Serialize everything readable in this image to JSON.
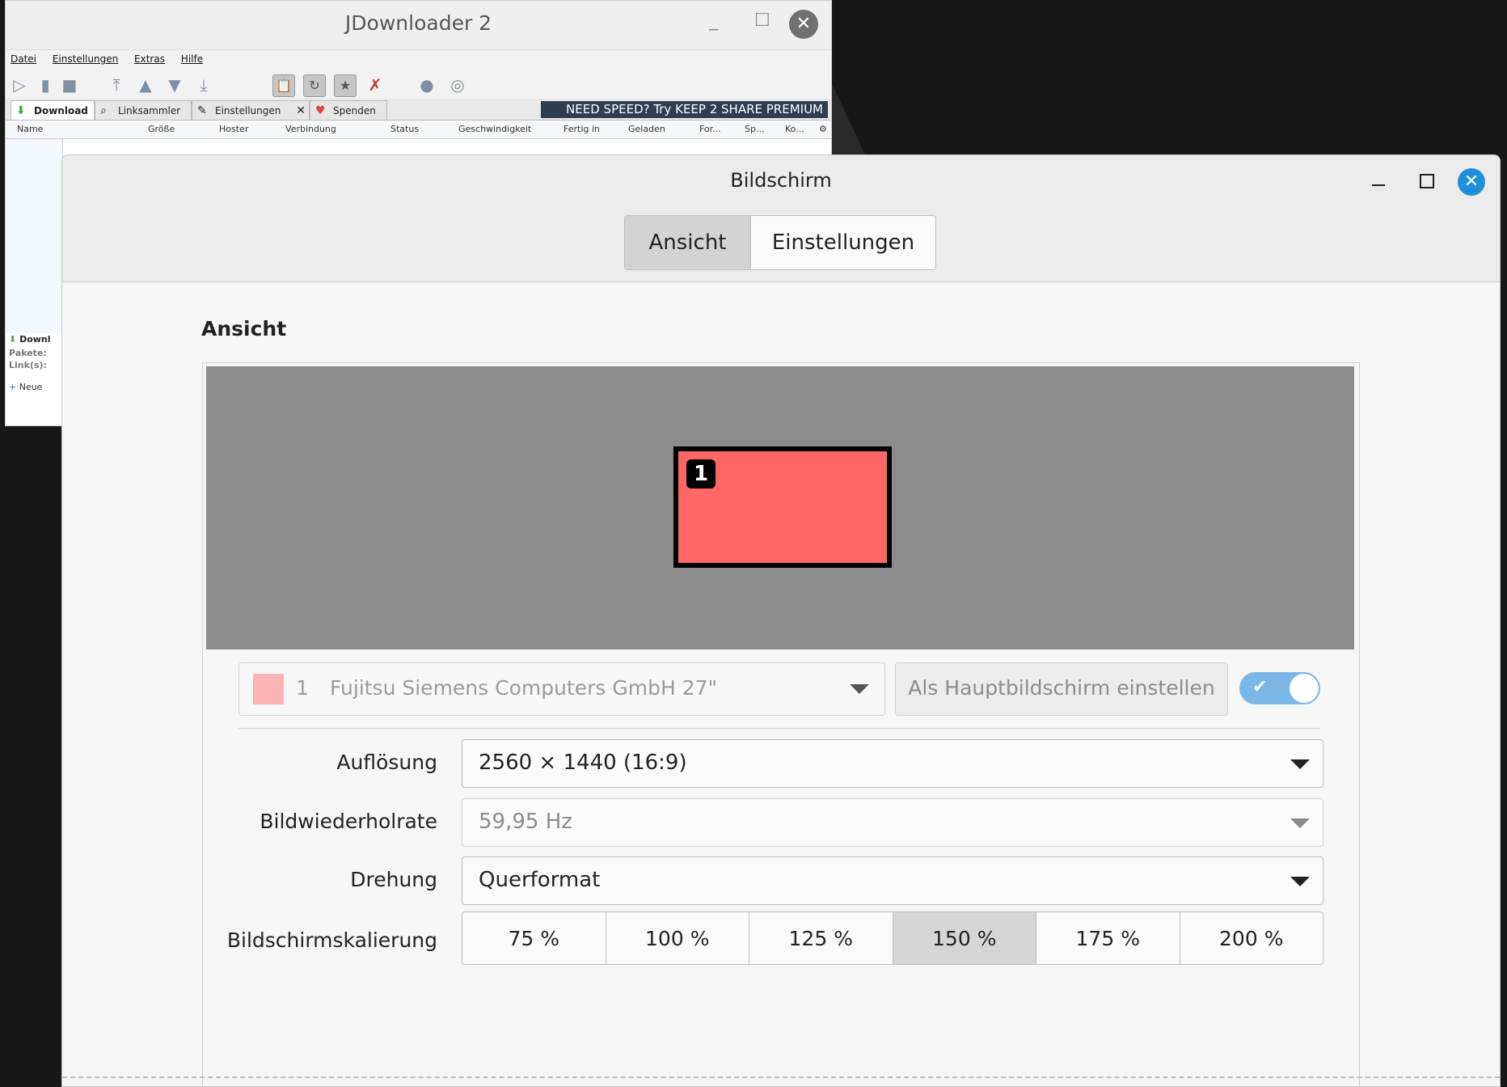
{
  "jdownloader": {
    "title": "JDownloader 2",
    "menu": [
      "Datei",
      "Einstellungen",
      "Extras",
      "Hilfe"
    ],
    "tabs": [
      "Download",
      "Linksammler",
      "Einstellungen",
      "Spenden"
    ],
    "banner": "NEED SPEED? Try KEEP 2 SHARE PREMIUM",
    "columns": [
      "Name",
      "Größe",
      "Hoster",
      "Verbindung",
      "Status",
      "Geschwindigkeit",
      "Fertig in",
      "Geladen",
      "For...",
      "Sp...",
      "Ko..."
    ],
    "bottom_panel": {
      "title": "Downl",
      "packages_label": "Pakete:",
      "links_label": "Link(s):",
      "new_button": "Neue"
    }
  },
  "display_window": {
    "title": "Bildschirm",
    "tabs": {
      "view": "Ansicht",
      "settings": "Einstellungen"
    },
    "section_title": "Ansicht",
    "monitor": {
      "number": "1",
      "name": "Fujitsu Siemens Computers GmbH 27\"",
      "color": "#fe6766",
      "swatch_color": "#fbb3b3"
    },
    "primary_button": "Als Hauptbildschirm einstellen",
    "enabled": true,
    "resolution": {
      "label": "Auflösung",
      "value": "2560 × 1440 (16:9)"
    },
    "refresh_rate": {
      "label": "Bildwiederholrate",
      "value": "59,95 Hz"
    },
    "rotation": {
      "label": "Drehung",
      "value": "Querformat"
    },
    "scaling": {
      "label": "Bildschirmskalierung",
      "options": [
        "75 %",
        "100 %",
        "125 %",
        "150 %",
        "175 %",
        "200 %"
      ],
      "selected": "150 %"
    }
  }
}
